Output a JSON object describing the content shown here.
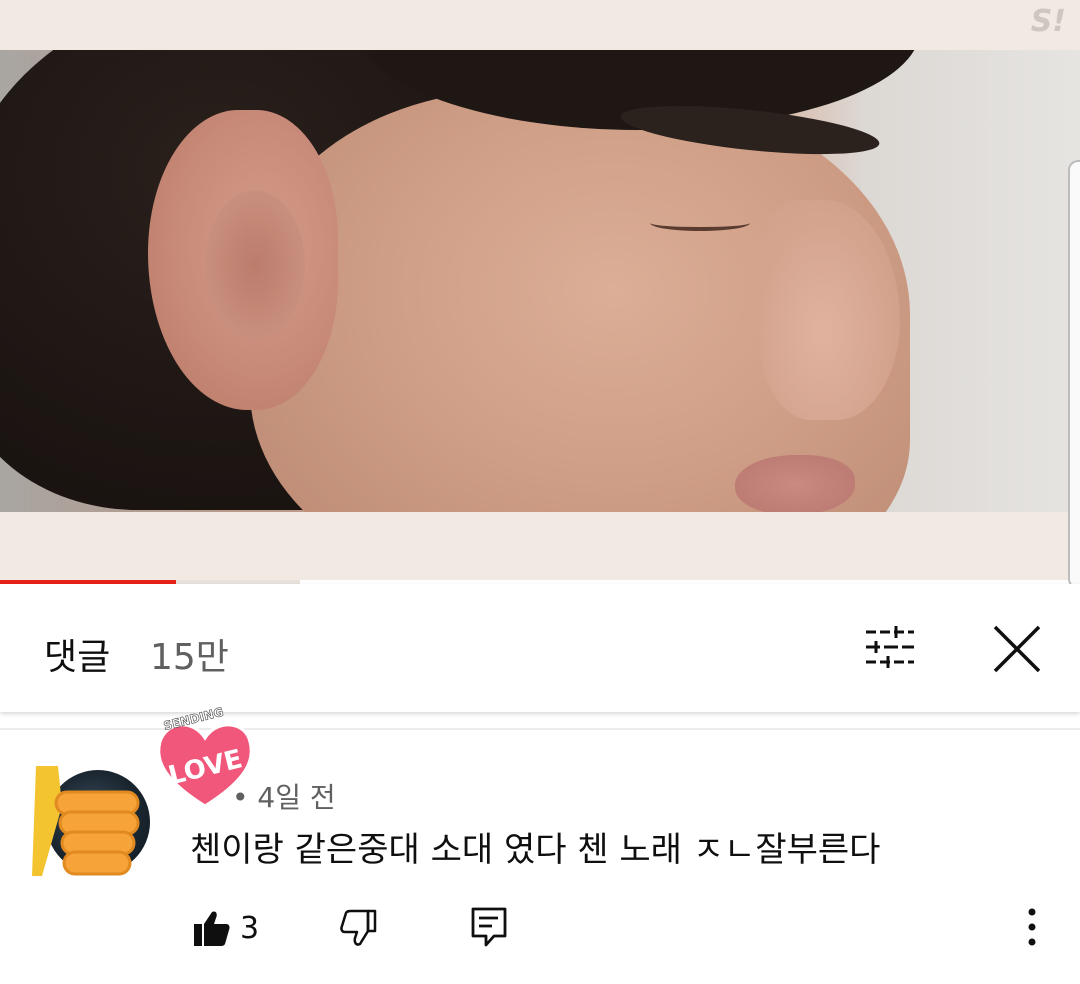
{
  "player": {
    "channel_logo_text": "S!",
    "progress_fraction": 0.587
  },
  "comments": {
    "title": "댓글",
    "count": "15만"
  },
  "comment": {
    "meta": "• 4일 전",
    "text": "첸이랑 같은중대 소대 였다 첸 노래 ㅈㄴ잘부른다",
    "like_count": "3",
    "sticker_love": "LOVE",
    "sticker_sending": "SENDING"
  },
  "colors": {
    "progress": "#e62117",
    "sticker_heart": "#f0577a",
    "sticker_thumb": "#f4c430"
  },
  "icons": [
    "sort-filter-icon",
    "close-icon",
    "thumb-up-icon",
    "thumb-down-icon",
    "reply-icon",
    "more-vert-icon"
  ]
}
